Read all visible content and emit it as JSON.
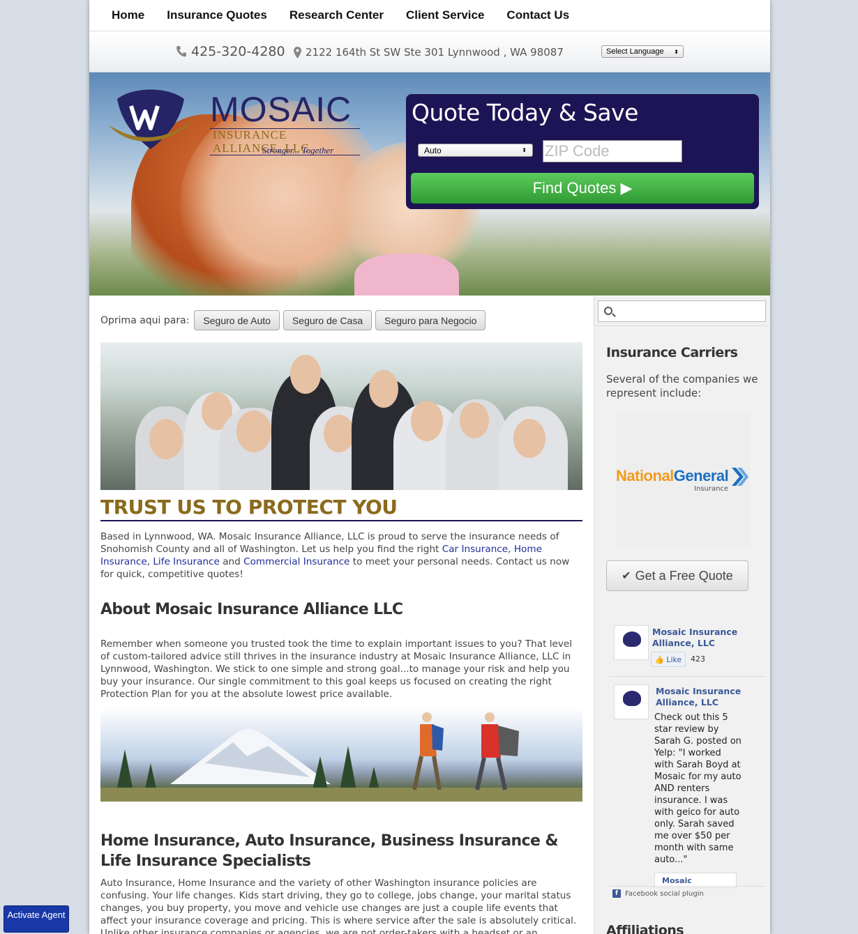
{
  "nav": {
    "items": [
      "Home",
      "Insurance Quotes",
      "Research Center",
      "Client Service",
      "Contact Us"
    ]
  },
  "infobar": {
    "phone": "425-320-4280",
    "address": "2122 164th St SW Ste 301 Lynnwood , WA 98087",
    "language_select": "Select Language"
  },
  "hero": {
    "logo_title": "MOSAIC",
    "logo_subtitle": "INSURANCE ALLIANCE, LLC",
    "logo_tagline": "Stronger... Together",
    "quote_title": "Quote Today & Save",
    "quote_type": "Auto",
    "zip_placeholder": "ZIP Code",
    "find_button": "Find Quotes ▶"
  },
  "spanish": {
    "label": "Oprima aqui para:",
    "buttons": [
      "Seguro de Auto",
      "Seguro de Casa",
      "Seguro para Negocio"
    ]
  },
  "content": {
    "trust_heading": "TRUST US TO PROTECT YOU",
    "intro_before": "Based in Lynnwood, WA. Mosaic Insurance Alliance, LLC is proud to serve the insurance needs of Snohomish County and all of Washington. Let us help you find the right ",
    "link_car": "Car Insurance",
    "link_home": "Home Insurance",
    "link_life": "Life Insurance",
    "link_commercial": "Commercial Insurance",
    "intro_after": " to meet your personal needs. Contact us now for quick, competitive quotes!",
    "about_heading": "About Mosaic Insurance Alliance LLC",
    "about_text": "Remember when someone you trusted took the time to explain important issues to you? That level of custom-tailored advice still thrives in the insurance industry at Mosaic Insurance Alliance, LLC in Lynnwood, Washington. We stick to one simple and strong goal...to manage your risk and help you buy your insurance. Our single commitment to this goal keeps us focused on creating the right Protection Plan for you at the absolute lowest price available.",
    "specialists_heading": "Home Insurance, Auto Insurance, Business Insurance & Life Insurance Specialists",
    "specialists_text": "Auto Insurance, Home Insurance and the variety of other Washington insurance policies are confusing. Your life changes. Kids start driving, they go to college, jobs change, your marital status changes, you buy property, you move and vehicle use changes are just a couple life events that affect your insurance coverage and pricing. This is where service after the sale is absolutely critical. Unlike other insurance companies or agencies, we are not order-takers with a headset or an answering machine."
  },
  "sidebar": {
    "carriers_heading": "Insurance Carriers",
    "carriers_text": "Several of the companies we represent include:",
    "carrier_name_a": "National",
    "carrier_name_b": "General",
    "carrier_sub": "Insurance",
    "free_quote_button": "Get a Free Quote",
    "fb_page_name": "Mosaic Insurance Alliance, LLC",
    "fb_like": "Like",
    "fb_like_count": "423",
    "fb_post": "Check out this 5 star review by Sarah G. posted on Yelp: \"I worked with Sarah Boyd at Mosaic for my auto AND renters insurance. I was with geico for auto only. Sarah saved me over $50 per month with same auto...\"",
    "fb_mini_name": "Mosaic",
    "fb_plugin": "Facebook social plugin",
    "affiliations_heading": "Affiliations"
  },
  "agent_button": "Activate Agent",
  "colors": {
    "navy": "#1c1454",
    "gold": "#8a6a1c",
    "green": "#3aa83e",
    "link": "#1e2d9a"
  }
}
